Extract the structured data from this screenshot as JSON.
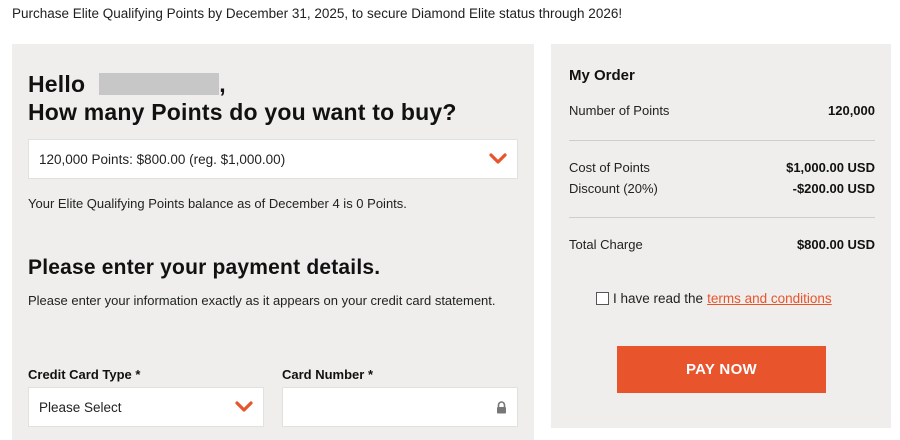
{
  "banner": {
    "text": "Purchase Elite Qualifying Points by December 31, 2025, to secure Diamond Elite status through 2026!"
  },
  "purchase": {
    "greeting_hello": "Hello",
    "greeting_comma": ",",
    "greeting_question": "How many Points do you want to buy?",
    "points_select_value": "120,000 Points: $800.00 (reg. $1,000.00)",
    "balance_text": "Your Elite Qualifying Points balance as of December 4 is 0 Points."
  },
  "payment": {
    "heading": "Please enter your payment details.",
    "instructions": "Please enter your information exactly as it appears on your credit card statement.",
    "card_type_label": "Credit Card Type *",
    "card_type_value": "Please Select",
    "card_number_label": "Card Number *",
    "card_number_value": ""
  },
  "order": {
    "title": "My Order",
    "number_of_points_label": "Number of Points",
    "number_of_points_value": "120,000",
    "cost_label": "Cost of Points",
    "cost_value": "$1,000.00 USD",
    "discount_label": "Discount (20%)",
    "discount_value": "-$200.00 USD",
    "total_label": "Total Charge",
    "total_value": "$800.00 USD",
    "terms_prefix": "I have read the",
    "terms_link": "terms and conditions",
    "pay_button": "PAY NOW"
  },
  "icons": {
    "dropdown": "chevron-down-icon",
    "lock": "lock-icon"
  },
  "colors": {
    "accent": "#e8542c",
    "panel_bg": "#efeeec"
  }
}
